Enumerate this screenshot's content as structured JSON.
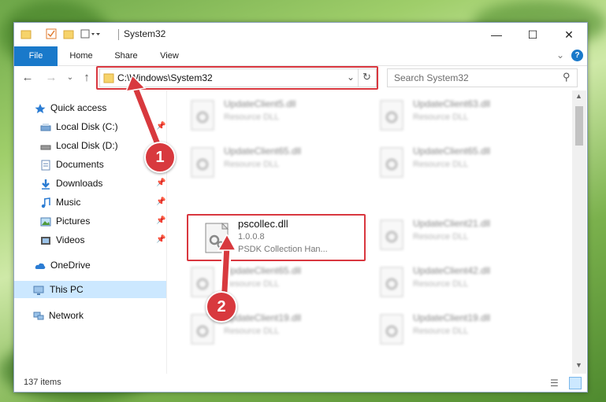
{
  "window": {
    "title": "System32"
  },
  "ribbon": {
    "tabs": [
      "File",
      "Home",
      "Share",
      "View"
    ]
  },
  "address": {
    "path": "C:\\Windows\\System32"
  },
  "search": {
    "placeholder": "Search System32"
  },
  "nav": {
    "quick_access": "Quick access",
    "items": [
      "Local Disk (C:)",
      "Local Disk (D:)",
      "Documents",
      "Downloads",
      "Music",
      "Pictures",
      "Videos"
    ],
    "onedrive": "OneDrive",
    "this_pc": "This PC",
    "network": "Network"
  },
  "files": [
    {
      "name": "UpdateClient5.dll",
      "type": "Resource DLL"
    },
    {
      "name": "UpdateClient63.dll",
      "type": "Resource DLL"
    },
    {
      "name": "UpdateClient65.dll",
      "type": "Resource DLL"
    },
    {
      "name": "UpdateClient65.dll",
      "type": "Resource DLL"
    },
    {
      "name": "pscollec.dll",
      "type": "1.0.0.8",
      "desc": "PSDK Collection Han..."
    },
    {
      "name": "UpdateClient21.dll",
      "type": "Resource DLL"
    },
    {
      "name": "UpdateClient65.dll",
      "type": "Resource DLL"
    },
    {
      "name": "UpdateClient42.dll",
      "type": "Resource DLL"
    },
    {
      "name": "UpdateClient19.dll",
      "type": "Resource DLL"
    },
    {
      "name": "UpdateClient19.dll",
      "type": "Resource DLL"
    }
  ],
  "status": {
    "count": "137 items"
  },
  "callouts": {
    "one": "1",
    "two": "2"
  },
  "colors": {
    "accent": "#1979ca",
    "highlight": "#d9373f"
  }
}
